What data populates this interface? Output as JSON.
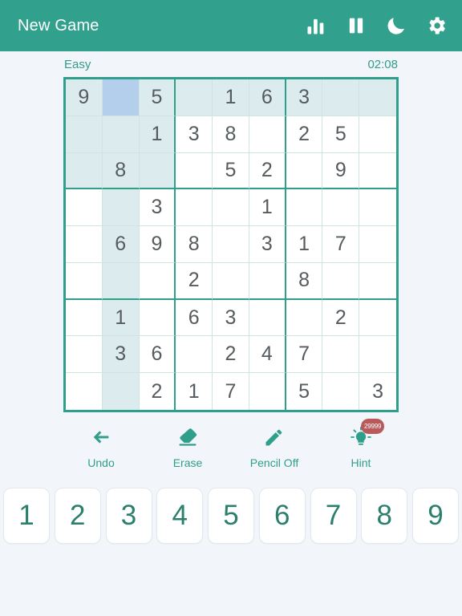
{
  "header": {
    "title": "New Game",
    "actions": [
      {
        "name": "stats-icon",
        "label": "Statistics"
      },
      {
        "name": "pause-icon",
        "label": "Pause"
      },
      {
        "name": "moon-icon",
        "label": "Dark Mode"
      },
      {
        "name": "gear-icon",
        "label": "Settings"
      }
    ]
  },
  "status": {
    "difficulty": "Easy",
    "timer": "02:08"
  },
  "board": {
    "selected": {
      "row": 0,
      "col": 1
    },
    "cells": [
      [
        "9",
        "",
        "5",
        "",
        "1",
        "6",
        "3",
        "",
        ""
      ],
      [
        "",
        "",
        "1",
        "3",
        "8",
        "",
        "2",
        "5",
        ""
      ],
      [
        "",
        "8",
        "",
        "",
        "5",
        "2",
        "",
        "9",
        ""
      ],
      [
        "",
        "",
        "3",
        "",
        "",
        "1",
        "",
        "",
        ""
      ],
      [
        "",
        "6",
        "9",
        "8",
        "",
        "3",
        "1",
        "7",
        ""
      ],
      [
        "",
        "",
        "",
        "2",
        "",
        "",
        "8",
        "",
        ""
      ],
      [
        "",
        "1",
        "",
        "6",
        "3",
        "",
        "",
        "2",
        ""
      ],
      [
        "",
        "3",
        "6",
        "",
        "2",
        "4",
        "7",
        "",
        ""
      ],
      [
        "",
        "",
        "2",
        "1",
        "7",
        "",
        "5",
        "",
        "3"
      ]
    ]
  },
  "tools": [
    {
      "name": "undo-button",
      "icon": "arrow-left-icon",
      "label": "Undo"
    },
    {
      "name": "erase-button",
      "icon": "eraser-icon",
      "label": "Erase"
    },
    {
      "name": "pencil-button",
      "icon": "pencil-icon",
      "label": "Pencil Off"
    },
    {
      "name": "hint-button",
      "icon": "lightbulb-icon",
      "label": "Hint",
      "badge": "29999"
    }
  ],
  "numpad": [
    "1",
    "2",
    "3",
    "4",
    "5",
    "6",
    "7",
    "8",
    "9"
  ],
  "colors": {
    "accent": "#31a08c",
    "accent_text": "#2f9e8a",
    "background": "#f2f5fa",
    "cell_selected": "#b3cfeb",
    "cell_peer": "#dcebee",
    "digit": "#555b5e",
    "numkey_text": "#2b7f6c",
    "badge": "#b85a5a"
  }
}
